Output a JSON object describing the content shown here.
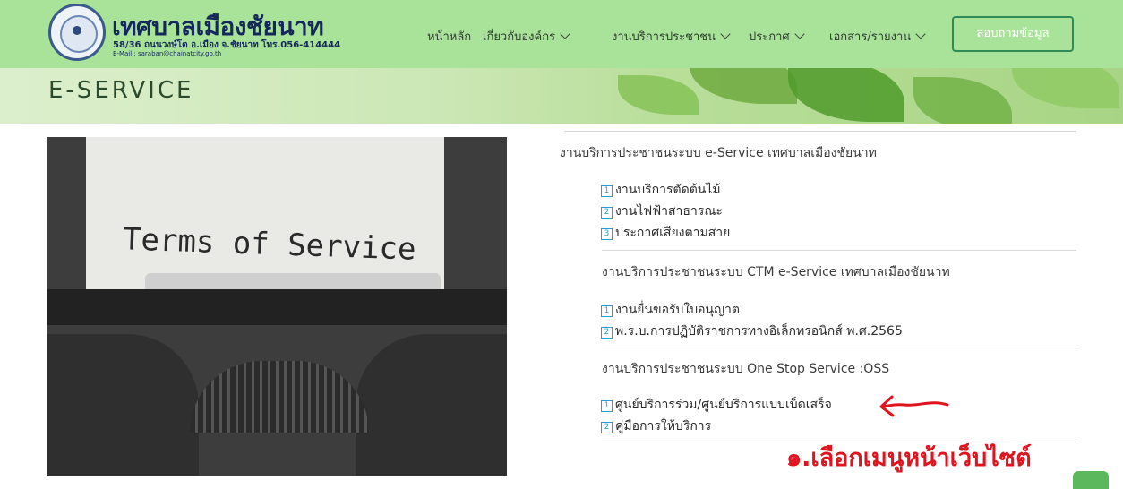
{
  "header": {
    "site_name": "เทศบาลเมืองชัยนาท",
    "address": "58/36 ถนนวงษ์โต อ.เมือง จ.ชัยนาท โทร.056-414444",
    "email": "E-Mail : saraban@chainatcity.go.th",
    "nav": {
      "home": "หน้าหลัก",
      "about": "เกี่ยวกับองค์กร",
      "services": "งานบริการประชาชน",
      "announce": "ประกาศ",
      "documents": "เอกสาร/รายงาน"
    },
    "contact_label": "สอบถามข้อมูล"
  },
  "banner": {
    "title": "E-SERVICE"
  },
  "image": {
    "text": "Terms of Service"
  },
  "sections": [
    {
      "heading": "งานบริการประชาชนระบบ e-Service เทศบาลเมืองชัยนาท",
      "items": [
        {
          "num": "1",
          "label": "งานบริการตัดต้นไม้"
        },
        {
          "num": "2",
          "label": "งานไฟฟ้าสาธารณะ"
        },
        {
          "num": "3",
          "label": "ประกาศเสียงตามสาย"
        }
      ]
    },
    {
      "heading": "งานบริการประชาชนระบบ CTM e-Service เทศบาลเมืองชัยนาท",
      "items": [
        {
          "num": "1",
          "label": "งานยื่นขอรับใบอนุญาต"
        },
        {
          "num": "2",
          "label": "พ.ร.บ.การปฏิบัติราชการทางอิเล็กทรอนิกส์ พ.ศ.2565"
        }
      ]
    },
    {
      "heading": "งานบริการประชาชนระบบ One Stop Service :OSS",
      "items": [
        {
          "num": "1",
          "label": "ศูนย์บริการร่วม/ศูนย์บริการแบบเบ็ดเสร็จ"
        },
        {
          "num": "2",
          "label": "คู่มือการให้บริการ"
        }
      ]
    }
  ],
  "annotation": {
    "text": "๑.เลือกเมนูหน้าเว็บไซต์",
    "color": "#e0141e"
  },
  "colors": {
    "header_bg": "#a9e39a",
    "accent": "#2e8b57",
    "link_num": "#2b9bd6"
  }
}
